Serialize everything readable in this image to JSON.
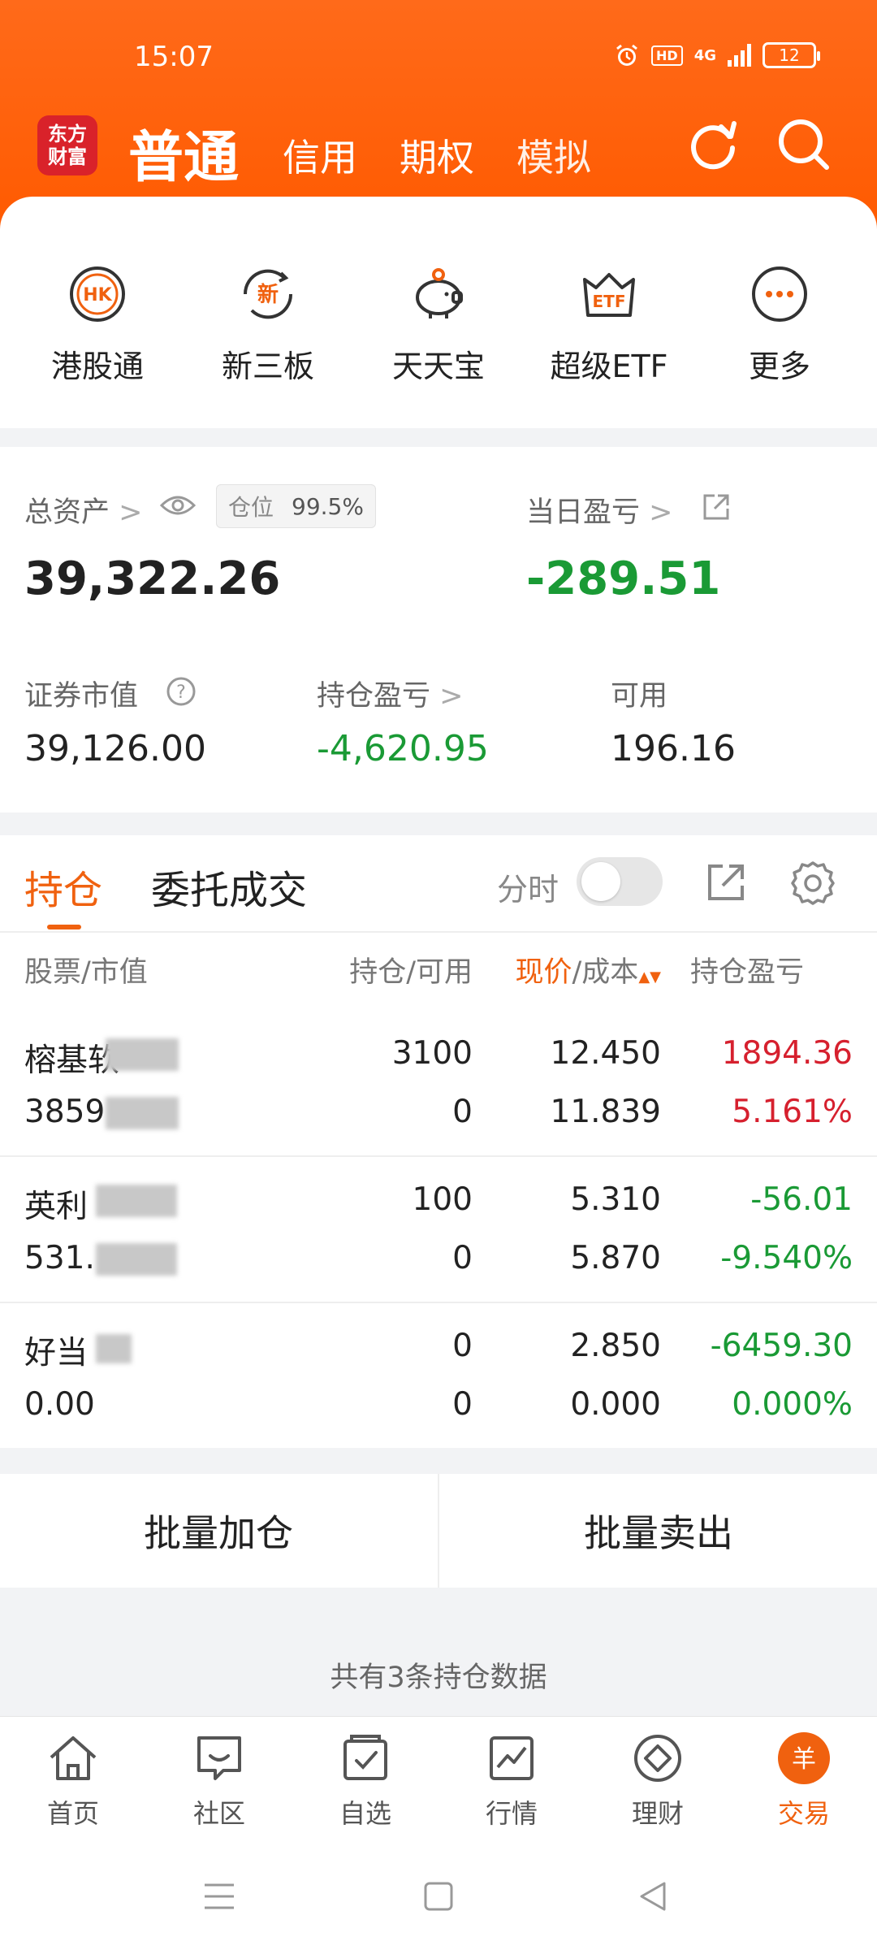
{
  "status_bar": {
    "time": "15:07",
    "network": "4G",
    "battery": "12"
  },
  "top_nav": {
    "logo_line1": "东方",
    "logo_line2": "财富",
    "tabs": [
      {
        "label": "普通",
        "active": true
      },
      {
        "label": "信用"
      },
      {
        "label": "期权"
      },
      {
        "label": "模拟"
      }
    ]
  },
  "quick_menu": [
    {
      "label": "港股通",
      "icon": "hk-icon",
      "icon_text": "HK"
    },
    {
      "label": "新三板",
      "icon": "new-board-icon",
      "icon_text": "新"
    },
    {
      "label": "天天宝",
      "icon": "piggy-bank-icon"
    },
    {
      "label": "超级ETF",
      "icon": "etf-crown-icon",
      "icon_text": "ETF"
    },
    {
      "label": "更多",
      "icon": "more-icon"
    }
  ],
  "assets": {
    "total_label": "总资产",
    "total_value": "39,322.26",
    "position_label": "仓位",
    "position_value": "99.5%",
    "daily_pnl_label": "当日盈亏",
    "daily_pnl_value": "-289.51",
    "market_value_label": "证券市值",
    "market_value": "39,126.00",
    "holding_pnl_label": "持仓盈亏",
    "holding_pnl_value": "-4,620.95",
    "available_label": "可用",
    "available_value": "196.16"
  },
  "holdings": {
    "tabs": [
      "持仓",
      "委托成交"
    ],
    "timeshare_label": "分时",
    "columns": {
      "stock": "股票/市值",
      "qty": "持仓/可用",
      "price_hl": "现价",
      "price_rest": "/成本",
      "pnl": "持仓盈亏"
    },
    "rows": [
      {
        "name": "榕基软",
        "market_value": "3859",
        "qty": "3100",
        "avail": "0",
        "price": "12.450",
        "cost": "11.839",
        "pnl": "1894.36",
        "pnl_pct": "5.161%",
        "tone": "red"
      },
      {
        "name": "英利",
        "market_value": "531.",
        "qty": "100",
        "avail": "0",
        "price": "5.310",
        "cost": "5.870",
        "pnl": "-56.01",
        "pnl_pct": "-9.540%",
        "tone": "green"
      },
      {
        "name": "好当",
        "market_value": "0.00",
        "qty": "0",
        "avail": "0",
        "price": "2.850",
        "cost": "0.000",
        "pnl": "-6459.30",
        "pnl_pct": "0.000%",
        "tone": "green"
      }
    ]
  },
  "actions": {
    "batch_add": "批量加仓",
    "batch_sell": "批量卖出"
  },
  "summary": "共有3条持仓数据",
  "tabbar": [
    {
      "label": "首页",
      "icon": "home-icon"
    },
    {
      "label": "社区",
      "icon": "community-icon"
    },
    {
      "label": "自选",
      "icon": "watchlist-icon"
    },
    {
      "label": "行情",
      "icon": "market-icon"
    },
    {
      "label": "理财",
      "icon": "wealth-icon"
    },
    {
      "label": "交易",
      "icon": "trade-icon",
      "active": true,
      "icon_text": "羊"
    }
  ],
  "colors": {
    "brand": "#ff5a00",
    "accent": "#f0610f",
    "up": "#d6202e",
    "down": "#1a9a35"
  }
}
